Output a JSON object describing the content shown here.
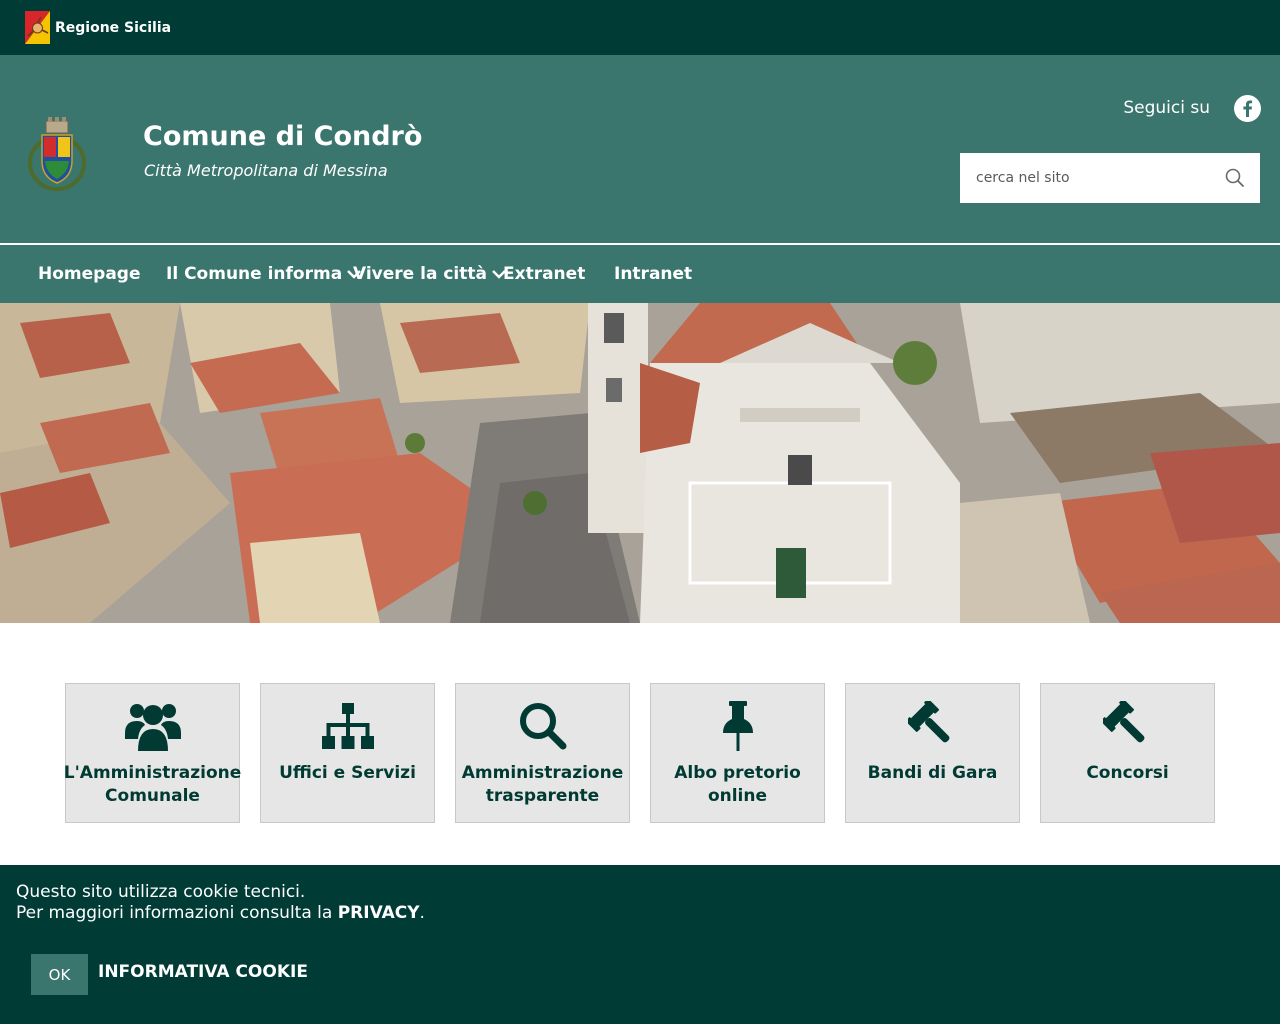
{
  "region": {
    "name": "Regione Sicilia"
  },
  "header": {
    "title": "Comune di Condrò",
    "subtitle": "Città Metropolitana di Messina",
    "follow_label": "Seguici su",
    "search_placeholder": "cerca nel sito"
  },
  "nav": {
    "items": [
      {
        "label": "Homepage"
      },
      {
        "label": "Il Comune informa"
      },
      {
        "label": "Vivere la città"
      },
      {
        "label": "Extranet"
      },
      {
        "label": "Intranet"
      }
    ]
  },
  "tiles": [
    {
      "label": "L'Amministrazione Comunale",
      "icon": "users-icon"
    },
    {
      "label": "Uffici e Servizi",
      "icon": "sitemap-icon"
    },
    {
      "label": "Amministrazione trasparente",
      "icon": "search-icon"
    },
    {
      "label": "Albo pretorio online",
      "icon": "pushpin-icon"
    },
    {
      "label": "Bandi di Gara",
      "icon": "gavel-icon"
    },
    {
      "label": "Concorsi",
      "icon": "gavel-icon"
    }
  ],
  "cookie": {
    "line1": "Questo sito utilizza cookie tecnici.",
    "line2_prefix": "Per maggiori informazioni consulta la ",
    "privacy_label": "PRIVACY",
    "line2_suffix": ".",
    "ok_label": "OK",
    "info_label": "INFORMATIVA COOKIE"
  },
  "colors": {
    "dark_green": "#003b36",
    "header_green": "#3a756e",
    "tile_bg": "#e6e6e6",
    "icon_color": "#003a33"
  }
}
